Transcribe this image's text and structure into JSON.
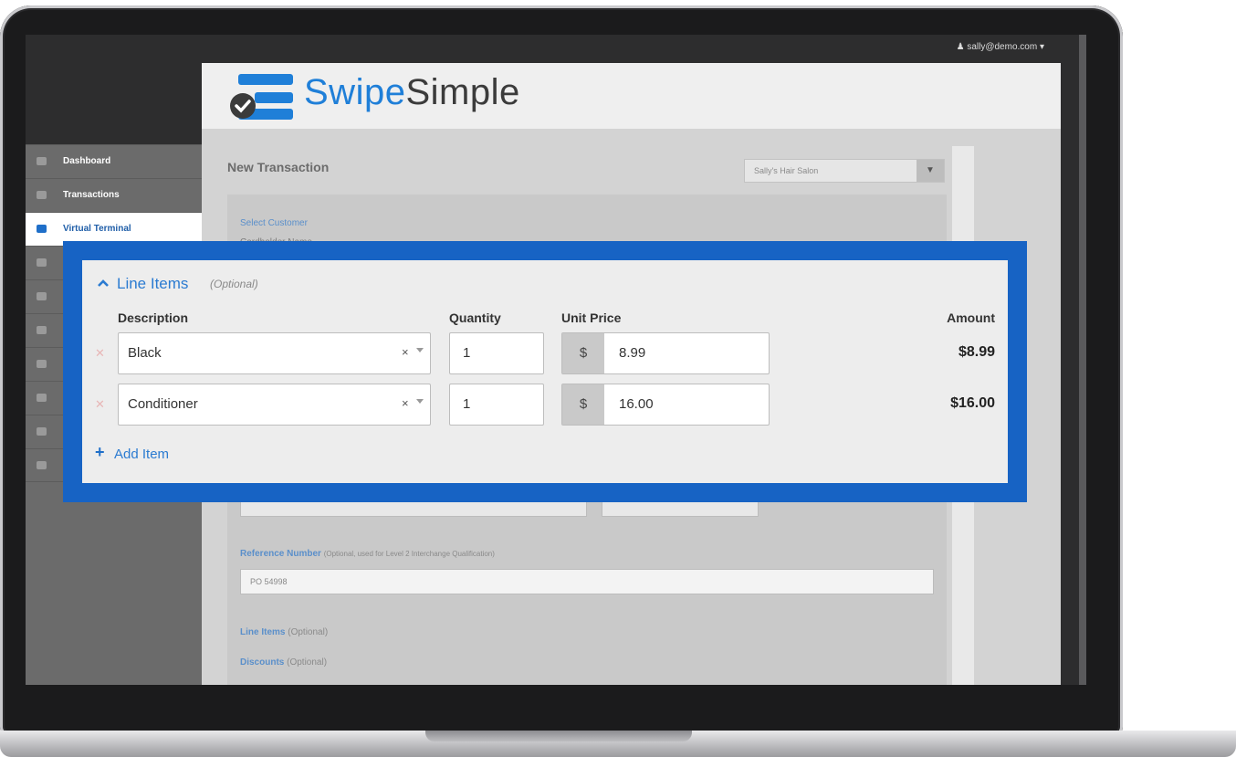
{
  "header": {
    "user_email": "sally@demo.com",
    "logo_swipe": "Swipe",
    "logo_simple": "Simple"
  },
  "sidebar": {
    "items": [
      {
        "label": "Dashboard",
        "icon": "dashboard-icon"
      },
      {
        "label": "Transactions",
        "icon": "transactions-icon"
      },
      {
        "label": "Virtual Terminal",
        "icon": "credit-card-icon",
        "active": true
      },
      {
        "label": "",
        "icon": "invoice-icon"
      },
      {
        "label": "",
        "icon": "document-icon"
      },
      {
        "label": "",
        "icon": "cart-icon"
      },
      {
        "label": "",
        "icon": "customers-icon"
      },
      {
        "label": "",
        "icon": "reports-icon"
      },
      {
        "label": "",
        "icon": "settings-icon"
      },
      {
        "label": "",
        "icon": "support-icon"
      }
    ]
  },
  "main": {
    "page_title": "New Transaction",
    "store_select": "Sally's Hair Salon",
    "select_customer": "Select Customer",
    "cardholder_name": "Cardholder Name",
    "reference_label": "Reference Number",
    "reference_note": "(Optional, used for Level 2 Interchange Qualification)",
    "reference_value": "PO 54998",
    "collapsed_line_items": "Line Items",
    "collapsed_line_items_opt": "(Optional)",
    "discounts": "Discounts",
    "discounts_opt": "(Optional)"
  },
  "line_items": {
    "title": "Line Items",
    "optional": "(Optional)",
    "headers": {
      "description": "Description",
      "quantity": "Quantity",
      "unit_price": "Unit Price",
      "amount": "Amount"
    },
    "currency_symbol": "$",
    "rows": [
      {
        "description": "Black",
        "quantity": "1",
        "unit_price": "8.99",
        "amount": "$8.99"
      },
      {
        "description": "Conditioner",
        "quantity": "1",
        "unit_price": "16.00",
        "amount": "$16.00"
      }
    ],
    "add_item": "Add Item"
  },
  "colors": {
    "accent_blue": "#1763c4",
    "link_blue": "#2b7bd1",
    "sidebar_bg": "#6b6b6b"
  }
}
